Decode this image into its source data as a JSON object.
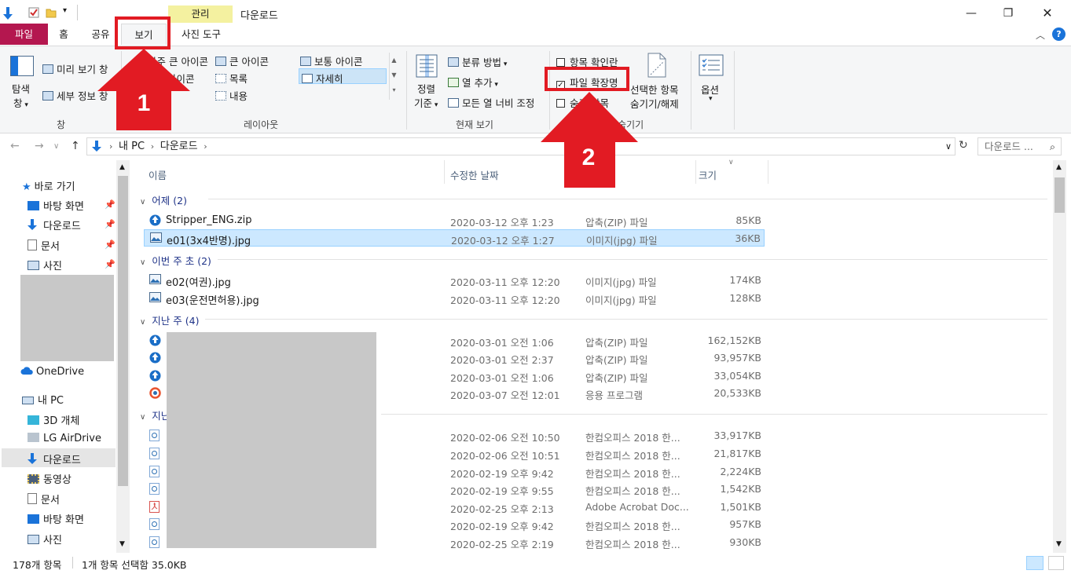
{
  "window": {
    "context_tab": "관리",
    "title": "다운로드"
  },
  "tabs": {
    "file": "파일",
    "home": "홈",
    "share": "공유",
    "view": "보기",
    "photo_tools": "사진 도구"
  },
  "ribbon": {
    "pane": {
      "nav_pane_line1": "탐색",
      "nav_pane_line2": "창",
      "preview": "미리 보기 창",
      "details": "세부 정보 창",
      "label": "창"
    },
    "layout": {
      "xl_icons": "아주 큰 아이콘",
      "large_icons": "큰 아이콘",
      "medium_icons": "보통 아이콘",
      "small_icons": "아이콘",
      "list": "목록",
      "details": "자세히",
      "content": "내용",
      "label": "레이아웃"
    },
    "current_view": {
      "sort_line1": "정렬",
      "sort_line2": "기준",
      "group_by": "분류 방법",
      "add_columns": "열 추가",
      "size_all": "모든 열 너비 조정",
      "label": "현재 보기"
    },
    "show_hide": {
      "item_checkboxes": "항목 확인란",
      "file_extensions": "파일 확장명",
      "hidden_items": "숨긴 항목",
      "hide_selected_line1": "선택한 항목",
      "hide_selected_line2": "숨기기/해제",
      "label": "숨기기",
      "file_extensions_checked": true
    },
    "options": "옵션"
  },
  "address": {
    "path": [
      "내 PC",
      "다운로드"
    ],
    "search_placeholder": "다운로드 ..."
  },
  "sidebar": {
    "quick_access": "바로 가기",
    "quick_items": [
      "바탕 화면",
      "다운로드",
      "문서",
      "사진"
    ],
    "onedrive": "OneDrive",
    "this_pc": "내 PC",
    "pc_items": [
      "3D 개체",
      "LG AirDrive",
      "다운로드",
      "동영상",
      "문서",
      "바탕 화면",
      "사진"
    ]
  },
  "columns": {
    "name": "이름",
    "date": "수정한 날짜",
    "type": "유형",
    "size": "크기"
  },
  "groups": [
    {
      "label": "어제",
      "count": "(2)"
    },
    {
      "label": "이번 주 초",
      "count": "(2)"
    },
    {
      "label": "지난 주",
      "count": "(4)"
    },
    {
      "label": "지난",
      "count": ""
    }
  ],
  "files": [
    {
      "name": "Stripper_ENG.zip",
      "date": "2020-03-12 오후 1:23",
      "type": "압축(ZIP) 파일",
      "size": "85KB",
      "icon": "zip-icon"
    },
    {
      "name": "e01(3x4반명).jpg",
      "date": "2020-03-12 오후 1:27",
      "type": "이미지(jpg) 파일",
      "size": "36KB",
      "icon": "image-icon"
    },
    {
      "name": "e02(여권).jpg",
      "date": "2020-03-11 오후 12:20",
      "type": "이미지(jpg) 파일",
      "size": "174KB",
      "icon": "image-icon"
    },
    {
      "name": "e03(운전면허용).jpg",
      "date": "2020-03-11 오후 12:20",
      "type": "이미지(jpg) 파일",
      "size": "128KB",
      "icon": "image-icon"
    },
    {
      "name": "",
      "date": "2020-03-01 오전 1:06",
      "type": "압축(ZIP) 파일",
      "size": "162,152KB",
      "icon": "zip-icon"
    },
    {
      "name": "",
      "date": "2020-03-01 오전 2:37",
      "type": "압축(ZIP) 파일",
      "size": "93,957KB",
      "icon": "zip-icon"
    },
    {
      "name": "",
      "date": "2020-03-01 오전 1:06",
      "type": "압축(ZIP) 파일",
      "size": "33,054KB",
      "icon": "zip-icon"
    },
    {
      "name": "",
      "date": "2020-03-07 오전 12:01",
      "type": "응용 프로그램",
      "size": "20,533KB",
      "icon": "app-icon"
    },
    {
      "name": "",
      "date": "2020-02-06 오전 10:50",
      "type": "한컴오피스 2018 한...",
      "size": "33,917KB",
      "icon": "hwp-icon"
    },
    {
      "name": "",
      "date": "2020-02-06 오전 10:51",
      "type": "한컴오피스 2018 한...",
      "size": "21,817KB",
      "icon": "hwp-icon"
    },
    {
      "name": "",
      "date": "2020-02-19 오후 9:42",
      "type": "한컴오피스 2018 한...",
      "size": "2,224KB",
      "icon": "hwp-icon"
    },
    {
      "name": "",
      "date": "2020-02-19 오후 9:55",
      "type": "한컴오피스 2018 한...",
      "size": "1,542KB",
      "icon": "hwp-icon"
    },
    {
      "name": "",
      "date": "2020-02-25 오후 2:13",
      "type": "Adobe Acrobat Doc...",
      "size": "1,501KB",
      "icon": "pdf-icon"
    },
    {
      "name": "",
      "date": "2020-02-19 오후 9:42",
      "type": "한컴오피스 2018 한...",
      "size": "957KB",
      "icon": "hwp-icon"
    },
    {
      "name": "",
      "date": "2020-02-25 오후 2:19",
      "type": "한컴오피스 2018 한...",
      "size": "930KB",
      "icon": "hwp-icon"
    }
  ],
  "status": {
    "count": "178개 항목",
    "selected": "1개 항목 선택함 35.0KB"
  },
  "annotations": {
    "step1": "1",
    "step2": "2",
    "color": "#e21b23"
  }
}
